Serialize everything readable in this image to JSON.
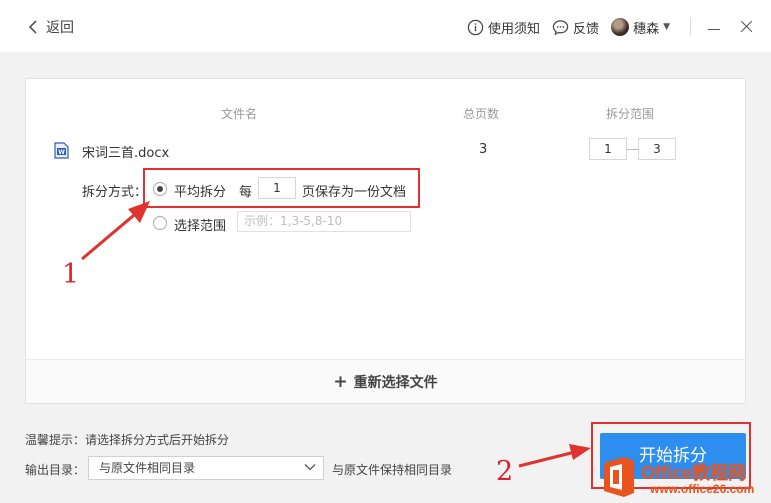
{
  "titlebar": {
    "back_label": "返回",
    "help_label": "使用须知",
    "feedback_label": "反馈",
    "username": "穗森"
  },
  "table": {
    "headers": [
      "文件名",
      "总页数",
      "拆分范围"
    ],
    "file_name": "宋词三首.docx",
    "total_pages": "3",
    "range_from": "1",
    "range_to": "3"
  },
  "split": {
    "mode_label": "拆分方式：",
    "option_even": "平均拆分",
    "every_label": "每",
    "pages_per_doc": "1",
    "pages_suffix": "页保存为一份文档",
    "option_range": "选择范围",
    "range_placeholder": "示例：1,3-5,8-10",
    "selected": "平均拆分"
  },
  "reselect_label": "重新选择文件",
  "footer": {
    "hint": "温馨提示：请选择拆分方式后开始拆分",
    "output_label": "输出目录：",
    "output_value": "与原文件相同目录",
    "output_desc": "与原文件保持相同目录",
    "start_button": "开始拆分"
  },
  "annotations": {
    "step1": "1",
    "step2": "2",
    "color": "#e0322f"
  },
  "watermark": {
    "name": "Office教程网",
    "url": "www.office26.com"
  },
  "colors": {
    "accent": "#2d8ef0",
    "file_icon": "#2b5fb4",
    "watermark": "#e9541e"
  }
}
